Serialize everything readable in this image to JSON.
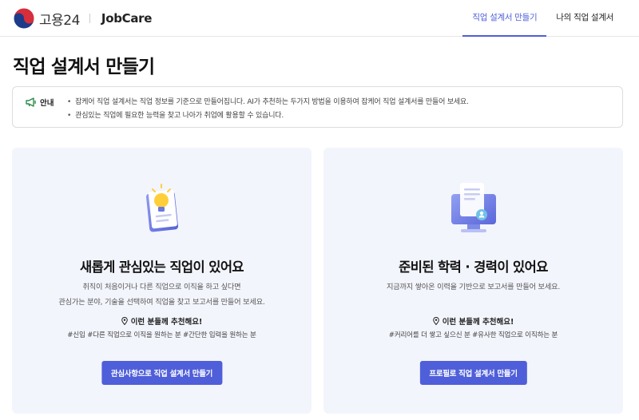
{
  "header": {
    "logo_text": "고용24",
    "brand": "JobCare",
    "nav": [
      {
        "label": "직업 설계서 만들기",
        "active": true
      },
      {
        "label": "나의 직업 설계서",
        "active": false
      }
    ]
  },
  "page_title": "직업 설계서 만들기",
  "notice": {
    "label": "안내",
    "items": [
      "잡케어 직업 설계서는 직업 정보를 기준으로 만들어집니다. AI가 추천하는 두가지 방법을 이용하여 잡케어 직업 설계서를 만들어 보세요.",
      "관심있는 직업에 필요한 능력을 찾고 나아가 취업에 활용할 수 있습니다."
    ]
  },
  "cards": [
    {
      "title": "새롭게 관심있는 직업이 있어요",
      "desc_lines": [
        "취직이 처음이거나 다른 직업으로 이직을 하고 싶다면",
        "관심가는 분야, 기술을 선택하여 직업을 찾고 보고서를 만들어 보세요."
      ],
      "rec_title": "이런 분들께 추천해요!",
      "rec_tags": "#신입  #다른 직업으로 이직을 원하는 분  #간단한 입력을 원하는 분",
      "button": "관심사항으로 직업 설계서 만들기",
      "icon": "lightbulb-document-icon"
    },
    {
      "title": "준비된 학력 · 경력이 있어요",
      "desc_lines": [
        "지금까지 쌓아온 이력을 기반으로 보고서를 만들어 보세요."
      ],
      "rec_title": "이런 분들께 추천해요!",
      "rec_tags": "#커리어를 더 쌓고 싶으신 분  #유사한 직업으로 이직하는 분",
      "button": "프로필로 직업 설계서 만들기",
      "icon": "monitor-document-icon"
    }
  ],
  "colors": {
    "accent": "#4f5fd9",
    "card_bg": "#f3f5fd",
    "notice_icon": "#2e8b4a"
  }
}
